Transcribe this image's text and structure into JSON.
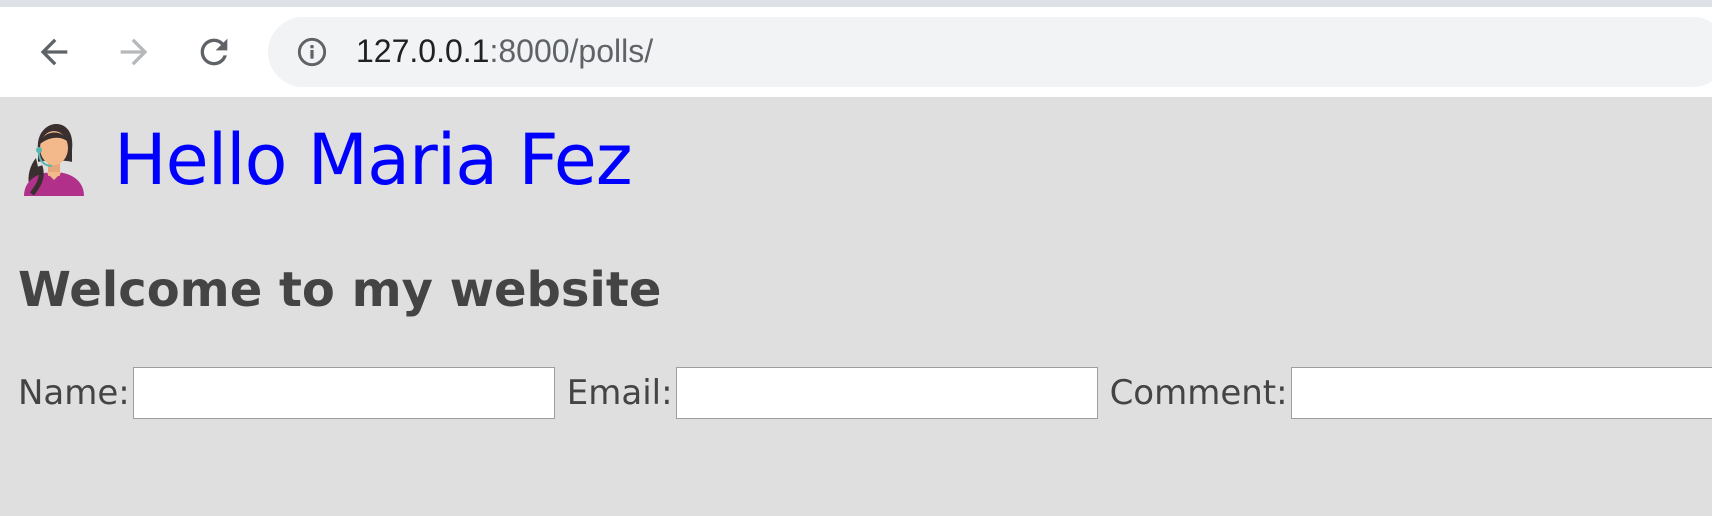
{
  "browser": {
    "url_host": "127.0.0.1",
    "url_path": ":8000/polls/",
    "icons": {
      "back": "arrow-left-icon",
      "forward": "arrow-right-icon",
      "reload": "reload-icon",
      "site_info": "info-icon"
    }
  },
  "page": {
    "greeting": "Hello Maria Fez",
    "greeting_color": "#0000ff",
    "welcome": "Welcome to my website",
    "form": {
      "name_label": "Name:",
      "name_value": "",
      "email_label": "Email:",
      "email_value": "",
      "comment_label": "Comment:",
      "comment_value": ""
    }
  },
  "colors": {
    "page_background": "#dfdfdf",
    "text": "#444444"
  }
}
